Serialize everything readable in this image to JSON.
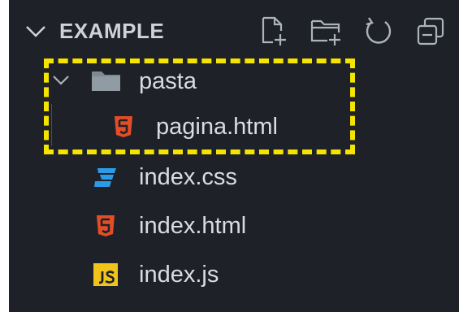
{
  "explorer": {
    "title": "EXAMPLE",
    "actions": [
      {
        "name": "new-file-button",
        "icon": "new-file-icon"
      },
      {
        "name": "new-folder-button",
        "icon": "new-folder-icon"
      },
      {
        "name": "refresh-button",
        "icon": "refresh-icon"
      },
      {
        "name": "collapse-all-button",
        "icon": "collapse-all-icon"
      }
    ],
    "tree": [
      {
        "label": "pasta",
        "type": "folder",
        "expanded": true,
        "icon": "folder-icon"
      },
      {
        "label": "pagina.html",
        "type": "file",
        "depth": 1,
        "icon": "html5-icon"
      },
      {
        "label": "index.css",
        "type": "file",
        "icon": "css3-icon"
      },
      {
        "label": "index.html",
        "type": "file",
        "icon": "html5-icon"
      },
      {
        "label": "index.js",
        "type": "file",
        "icon": "javascript-icon"
      }
    ]
  },
  "colors": {
    "background": "#1e2228",
    "text": "#d9dde2",
    "html": "#e44d26",
    "css": "#2b9be8",
    "js": "#f0c419",
    "highlight": "#f5e400"
  }
}
